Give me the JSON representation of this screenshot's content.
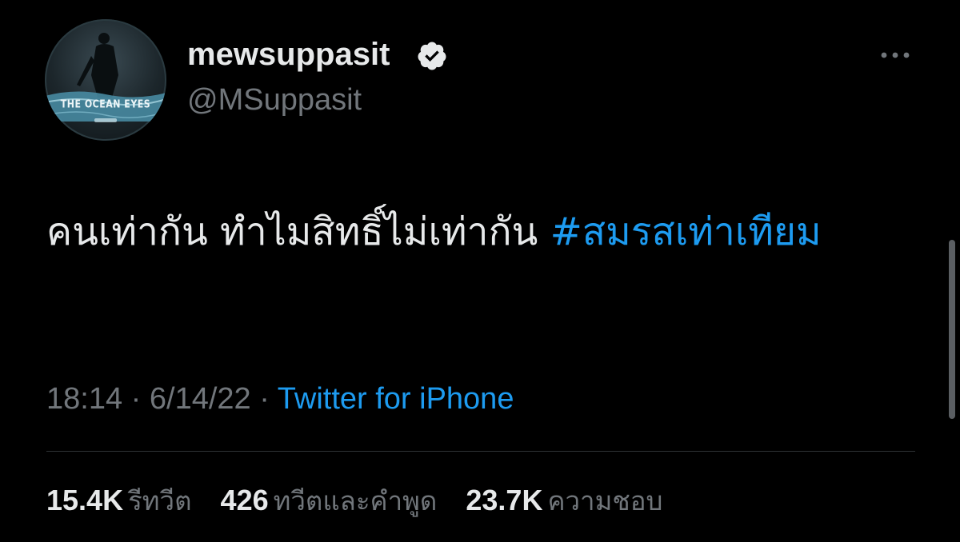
{
  "user": {
    "display_name": "mewsuppasit",
    "handle": "@MSuppasit",
    "verified": true,
    "avatar_caption": "THE OCEAN EYES"
  },
  "tweet": {
    "text": "คนเท่ากัน ทำไมสิทธิ์ไม่เท่ากัน ",
    "hashtag": "#สมรสเท่าเทียม"
  },
  "meta": {
    "time": "18:14",
    "separator": " · ",
    "date": "6/14/22",
    "source": "Twitter for iPhone"
  },
  "stats": [
    {
      "value": "15.4K",
      "label": "รีทวีต"
    },
    {
      "value": "426",
      "label": "ทวีตและคำพูด"
    },
    {
      "value": "23.7K",
      "label": "ความชอบ"
    }
  ],
  "icons": {
    "verified": "verified-badge-icon",
    "more": "more-options-icon"
  },
  "colors": {
    "background": "#000000",
    "text_primary": "#e7e9ea",
    "text_secondary": "#71767b",
    "accent": "#1d9bf0",
    "divider": "#2f3336"
  }
}
